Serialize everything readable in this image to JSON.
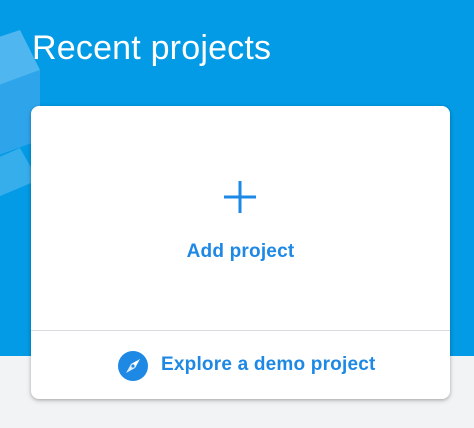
{
  "header": {
    "title": "Recent projects",
    "background_color": "#039be5",
    "illustration_icon": "decorative-isometric-shape-icon"
  },
  "card": {
    "add_project": {
      "label": "Add project",
      "icon": "plus-icon"
    },
    "explore_demo": {
      "label": "Explore a demo project",
      "icon": "compass-icon"
    },
    "accent_color": "#1e88e5"
  },
  "page": {
    "background_color": "#f1f3f4"
  }
}
